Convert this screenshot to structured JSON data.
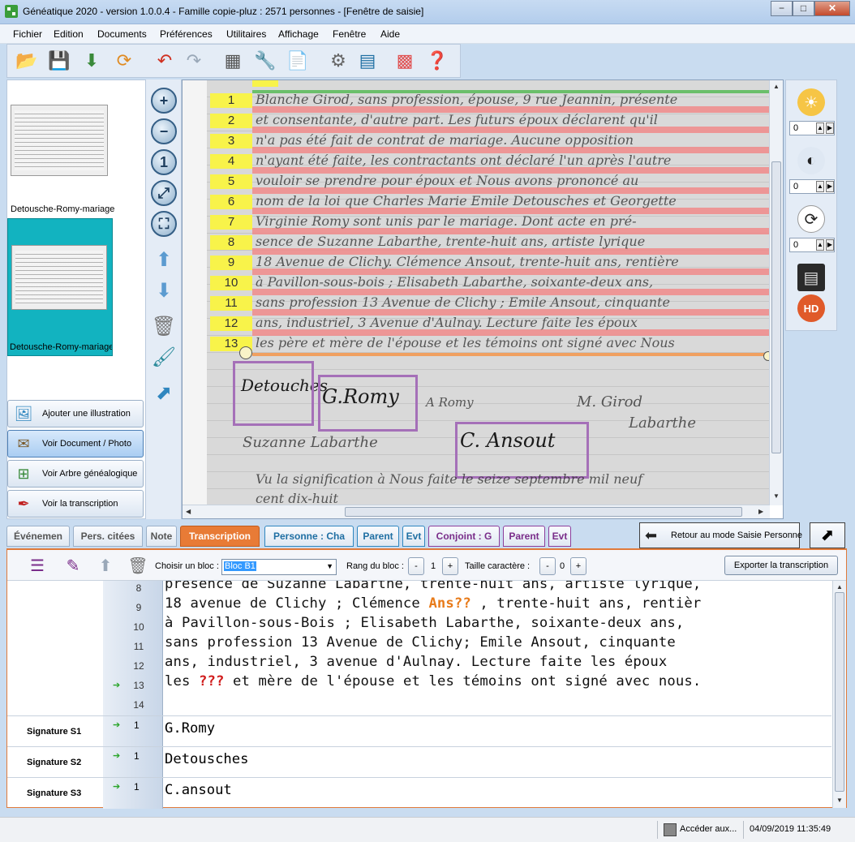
{
  "window": {
    "title": "Généatique 2020 - version 1.0.0.4 - Famille copie-pluz : 2571 personnes - [Fenêtre de saisie]",
    "minimize": "−",
    "maximize": "□",
    "close": "✕"
  },
  "menu": [
    "Fichier",
    "Edition",
    "Documents",
    "Préférences",
    "Utilitaires",
    "Affichage",
    "Fenêtre",
    "Aide"
  ],
  "left_panel": {
    "thumb1_label": "Detousche-Romy-mariage",
    "thumb2_label": "Detousche-Romy-mariage",
    "buttons": {
      "add_illustration": "Ajouter une illustration",
      "view_document": "Voir Document / Photo",
      "view_tree": "Voir Arbre généalogique",
      "view_transcription": "Voir la transcription"
    }
  },
  "document": {
    "line_numbers": [
      "1",
      "2",
      "3",
      "4",
      "5",
      "6",
      "7",
      "8",
      "9",
      "10",
      "11",
      "12",
      "13"
    ],
    "handwriting": [
      "Blanche Girod, sans profession, épouse, 9 rue Jeannin, présente",
      "et consentante, d'autre part. Les futurs époux déclarent qu'il",
      "n'a pas été fait de contrat de mariage. Aucune opposition",
      "n'ayant été faite, les contractants ont déclaré l'un après l'autre",
      "vouloir se prendre pour époux et Nous avons prononcé au",
      "nom de la loi que Charles Marie Emile Detousches et Georgette",
      "Virginie Romy sont unis par le mariage. Dont acte en pré-",
      "sence de Suzanne Labarthe, trente-huit ans, artiste lyrique",
      "18 Avenue de Clichy. Clémence Ansout, trente-huit ans, rentière",
      "à Pavillon-sous-bois ; Elisabeth Labarthe, soixante-deux ans,",
      "sans profession 13 Avenue de Clichy ; Emile Ansout, cinquante",
      "ans, industriel, 3 Avenue d'Aulnay. Lecture faite les époux",
      "les père et mère de l'épouse et les témoins ont signé avec Nous"
    ],
    "signatures": [
      "Detouches",
      "G.Romy",
      "C. Ansout",
      "Suzanne Labarthe",
      "M. Girod",
      "Labarthe",
      "A Romy"
    ],
    "bottom_lines": [
      "Vu la signification à Nous faite le seize septembre mil neuf",
      "cent dix-huit"
    ]
  },
  "tabs": [
    {
      "label": "Événemen",
      "style": "normal"
    },
    {
      "label": "Pers. citées",
      "style": "normal"
    },
    {
      "label": "Note",
      "style": "normal"
    },
    {
      "label": "Transcription",
      "style": "active"
    },
    {
      "label": "Personne : Cha",
      "style": "blue"
    },
    {
      "label": "Parent",
      "style": "blue"
    },
    {
      "label": "Evt",
      "style": "blue"
    },
    {
      "label": "Conjoint : G",
      "style": "purple"
    },
    {
      "label": "Parent",
      "style": "purple"
    },
    {
      "label": "Evt",
      "style": "purple"
    }
  ],
  "back_button": "Retour au mode Saisie Personne",
  "transcription_toolbar": {
    "choose_block_label": "Choisir un bloc :",
    "block_value": "Bloc B1",
    "rank_label": "Rang du bloc :",
    "rank_value": "1",
    "size_label": "Taille caractère :",
    "size_value": "0",
    "minus": "-",
    "plus": "+",
    "export_button": "Exporter la transcription"
  },
  "editor_lines": [
    {
      "num": "8",
      "segments": [
        {
          "t": "présence de Suzanne Labarthe, trente-huit ans, artiste lyrique,",
          "s": ""
        }
      ]
    },
    {
      "num": "9",
      "segments": [
        {
          "t": "18 avenue de Clichy ; Clémence ",
          "s": ""
        },
        {
          "t": "Ans??",
          "s": "orange"
        },
        {
          "t": " , trente-huit ans, rentièr",
          "s": ""
        }
      ]
    },
    {
      "num": "10",
      "segments": [
        {
          "t": "à Pavillon-sous-Bois ; Elisabeth Labarthe, soixante-deux ans,",
          "s": ""
        }
      ]
    },
    {
      "num": "11",
      "segments": [
        {
          "t": "sans profession 13 Avenue de Clichy; Emile Ansout, cinquante",
          "s": ""
        }
      ]
    },
    {
      "num": "12",
      "segments": [
        {
          "t": "ans, industriel, 3 avenue d'Aulnay. Lecture faite les époux",
          "s": ""
        }
      ]
    },
    {
      "num": "13",
      "arrow": true,
      "segments": [
        {
          "t": "les ",
          "s": ""
        },
        {
          "t": "???",
          "s": "red"
        },
        {
          "t": " et mère de l'épouse et les témoins ont signé avec nous.",
          "s": ""
        }
      ]
    },
    {
      "num": "14",
      "segments": []
    }
  ],
  "signature_rows": [
    {
      "label": "Signature S1",
      "num": "1",
      "text": "G.Romy"
    },
    {
      "label": "Signature S2",
      "num": "1",
      "text": "Detousches"
    },
    {
      "label": "Signature S3",
      "num": "1",
      "text": "C.ansout"
    }
  ],
  "status": {
    "access": "Accéder aux...",
    "datetime": "04/09/2019 11:35:49"
  }
}
